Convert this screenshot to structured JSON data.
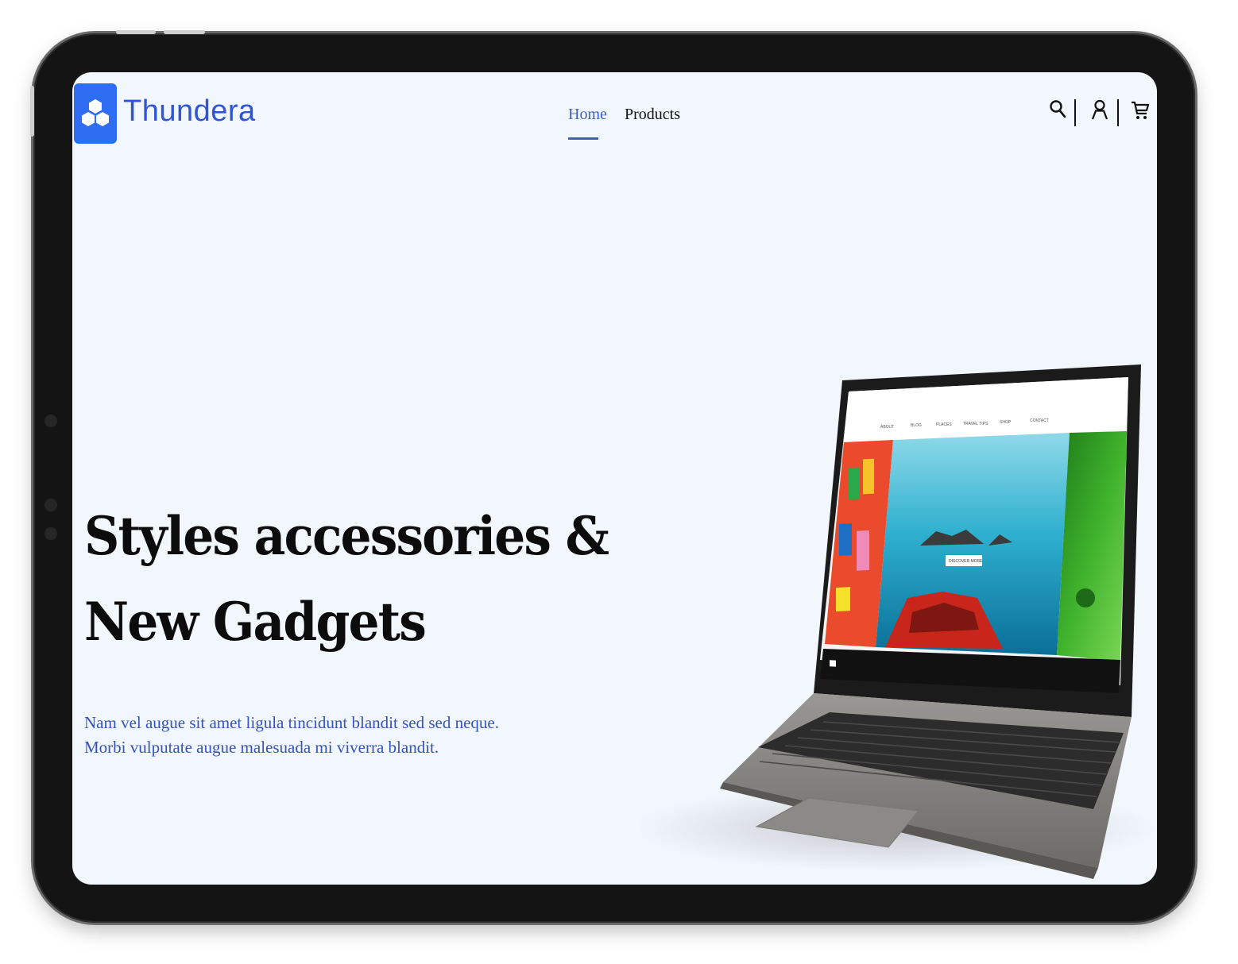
{
  "brand": {
    "name": "Thundera",
    "accent_color": "#2f6df2",
    "logo_icon": "hexagon-cluster-icon"
  },
  "nav": {
    "items": [
      {
        "label": "Home",
        "active": true
      },
      {
        "label": "Products",
        "active": false
      }
    ]
  },
  "header_icons": [
    "search-icon",
    "user-icon",
    "cart-icon"
  ],
  "hero": {
    "title_line1": "Styles accessories &",
    "title_line2": "New Gadgets",
    "subtitle_line1": "Nam vel augue sit amet ligula tincidunt blandit sed sed neque.",
    "subtitle_line2": "Morbi vulputate augue malesuada mi viverra blandit."
  },
  "laptop_screen": {
    "menu": [
      "ABOUT",
      "BLOG",
      "PLACES",
      "TRAVEL TIPS",
      "SHOP",
      "CONTACT"
    ],
    "button": "DISCOVER MORE"
  }
}
